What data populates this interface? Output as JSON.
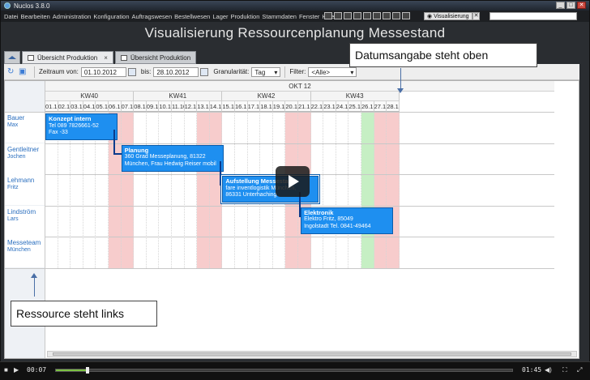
{
  "window": {
    "title": "Nuclos 3.8.0"
  },
  "menu": {
    "items": [
      "Datei",
      "Bearbeiten",
      "Administration",
      "Konfiguration",
      "Auftragswesen",
      "Bestellwesen",
      "Lager",
      "Produktion",
      "Stammdaten",
      "Fenster",
      "Hilfe"
    ],
    "visualisierung_label": "Visualisierung"
  },
  "header": {
    "title": "Visualisierung Ressourcenplanung Messestand"
  },
  "tabs": [
    {
      "label": "Übersicht Produktion",
      "active": true
    },
    {
      "label": "Übersicht Produktion",
      "active": false
    }
  ],
  "toolbar": {
    "zeitraum_label": "Zeitraum von:",
    "date_from": "01.10.2012",
    "bis_label": "bis:",
    "date_to": "28.10.2012",
    "granularitaet_label": "Granularität:",
    "granularitaet_value": "Tag",
    "filter_label": "Filter:",
    "filter_value": "<Alle>"
  },
  "calendar": {
    "month": "OKT 12",
    "weeks": [
      "KW40",
      "KW41",
      "KW42",
      "KW43"
    ],
    "days": [
      "01.10",
      "02.10",
      "03.10",
      "04.10",
      "05.10",
      "06.10",
      "07.10",
      "08.10",
      "09.10",
      "10.10",
      "11.10",
      "12.10",
      "13.10",
      "14.10",
      "15.10",
      "16.10",
      "17.10",
      "18.10",
      "19.10",
      "20.10",
      "21.10",
      "22.10",
      "23.10",
      "24.10",
      "25.10",
      "26.10",
      "27.10",
      "28.10"
    ],
    "weekend_days": [
      5,
      6,
      12,
      13,
      19,
      20,
      26,
      27
    ],
    "holiday_days": [
      25
    ],
    "resources": [
      {
        "name": "Bauer",
        "sub": "Max"
      },
      {
        "name": "Gentleitner",
        "sub": "Jochen"
      },
      {
        "name": "Lehmann",
        "sub": "Fritz"
      },
      {
        "name": "Lindström",
        "sub": "Lars"
      },
      {
        "name": "Messeteam",
        "sub": "München"
      }
    ],
    "tasks": [
      {
        "row": 0,
        "start": 0,
        "end": 5.7,
        "title": "Konzept intern",
        "line1": "Tel 089 7826661-52",
        "line2": "Fax -33"
      },
      {
        "row": 1,
        "start": 6,
        "end": 14.1,
        "title": "Planung",
        "line1": "360 Grad Messeplanung, 81322",
        "line2": "München, Frau Hedwig Reiser mobil"
      },
      {
        "row": 2,
        "start": 14,
        "end": 21.6,
        "title": "Aufstellung Messestand",
        "line1": "fare inventlogistik München,",
        "line2": "86331 Unterhaching"
      },
      {
        "row": 3,
        "start": 20.2,
        "end": 27.5,
        "title": "Elektronik",
        "line1": "Elektro Fritz, 85049",
        "line2": "Ingolstadt Tel. 0841-49464"
      }
    ]
  },
  "callouts": {
    "top": "Datumsangabe steht oben",
    "left": "Ressource steht links"
  },
  "player": {
    "elapsed": "00:07",
    "total": "01:45",
    "progress": 0.07
  }
}
